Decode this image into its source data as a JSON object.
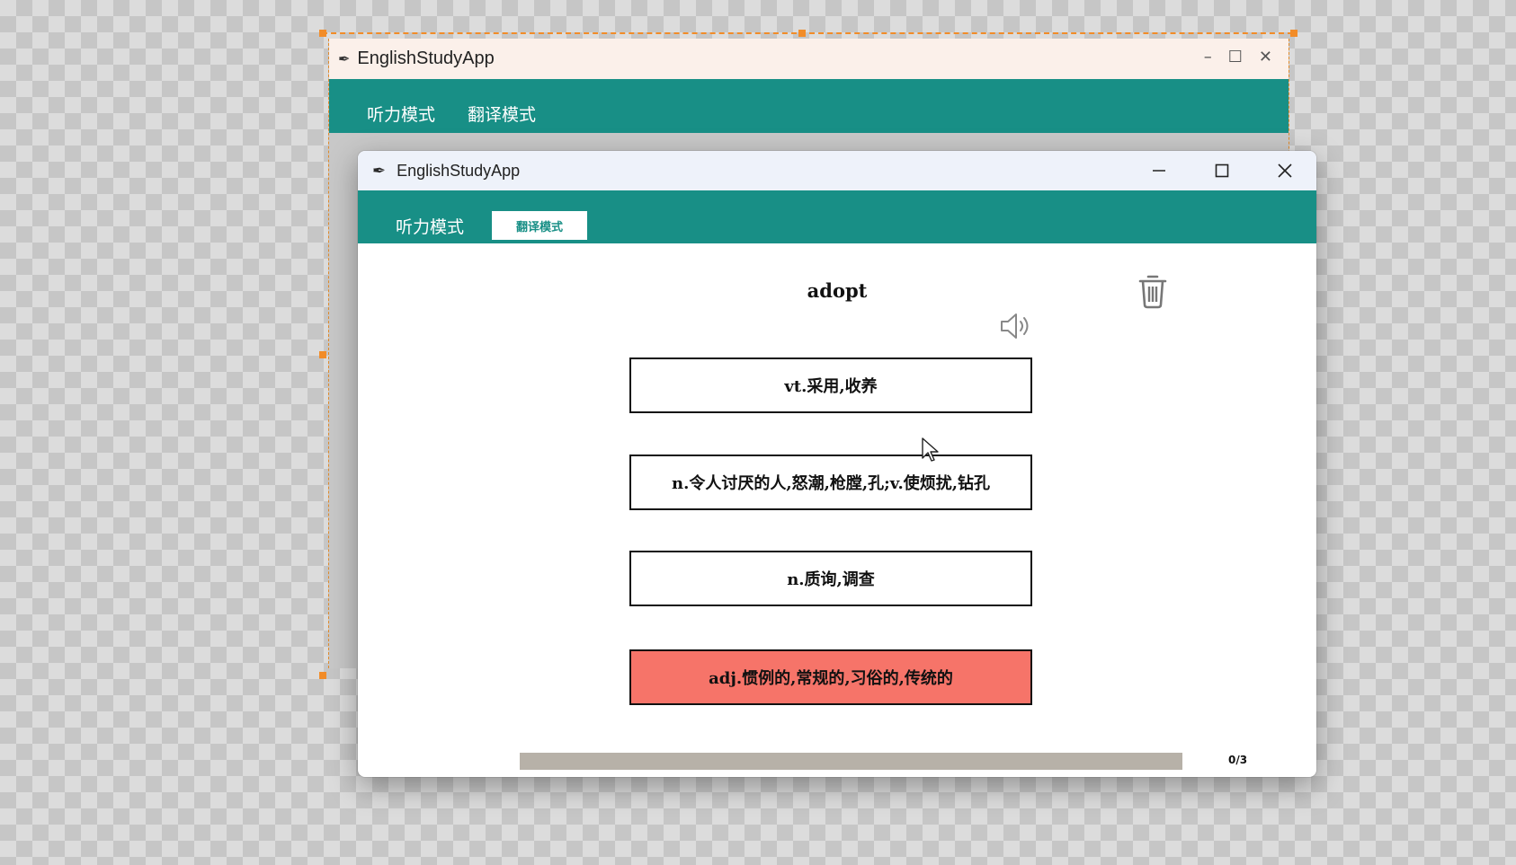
{
  "background_window": {
    "title": "EnglishStudyApp",
    "tabs": [
      {
        "label": "听力模式"
      },
      {
        "label": "翻译模式"
      }
    ]
  },
  "window": {
    "title": "EnglishStudyApp",
    "controls": {
      "minimize": "—",
      "maximize": "☐",
      "close": "✕"
    }
  },
  "tabs": {
    "listen_label": "听力模式",
    "translate_label": "翻译模式",
    "active": "翻译模式"
  },
  "quiz": {
    "word": "adopt",
    "options": [
      {
        "text": "vt.采用,收养",
        "state": "normal"
      },
      {
        "text": "n.令人讨厌的人,怒潮,枪膛,孔;v.使烦扰,钻孔",
        "state": "normal"
      },
      {
        "text": "n.质询,调查",
        "state": "normal"
      },
      {
        "text": "adj.惯例的,常规的,习俗的,传统的",
        "state": "wrong"
      }
    ]
  },
  "progress": {
    "label": "0/3",
    "current": 0,
    "total": 3,
    "fraction": 0
  },
  "colors": {
    "accent": "#188f86",
    "wrong": "#f67469",
    "track": "#b7b1a8"
  },
  "icons": {
    "delete": "trash-icon",
    "audio": "speaker-icon",
    "app": "feather-icon"
  }
}
